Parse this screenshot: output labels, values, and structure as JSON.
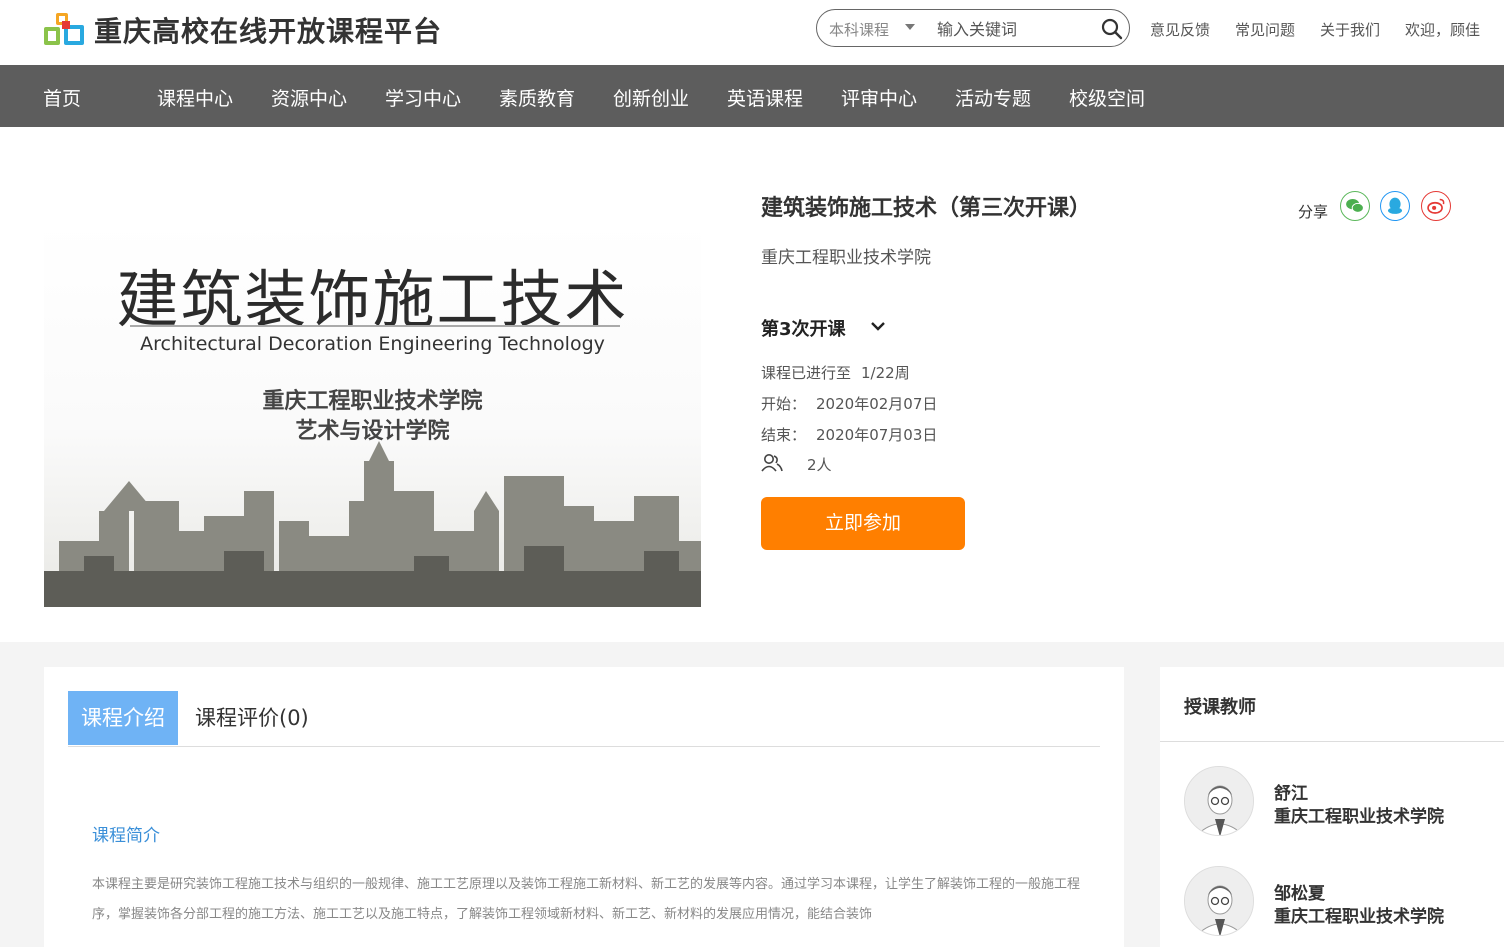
{
  "header": {
    "site_title": "重庆高校在线开放课程平台",
    "search": {
      "category": "本科课程",
      "placeholder": "输入关键词"
    },
    "links": [
      "意见反馈",
      "常见问题",
      "关于我们",
      "欢迎，顾佳"
    ]
  },
  "nav": {
    "items": [
      "首页",
      "课程中心",
      "资源中心",
      "学习中心",
      "素质教育",
      "创新创业",
      "英语课程",
      "评审中心",
      "活动专题",
      "校级空间"
    ]
  },
  "course": {
    "cover": {
      "title": "建筑装饰施工技术",
      "subtitle_en": "Architectural Decoration Engineering Technology",
      "school_line1": "重庆工程职业技术学院",
      "school_line2": "艺术与设计学院"
    },
    "title": "建筑装饰施工技术（第三次开课）",
    "share_label": "分享",
    "share_icons": [
      "wechat-icon",
      "qq-icon",
      "weibo-icon"
    ],
    "school": "重庆工程职业技术学院",
    "session": "第3次开课",
    "progress_label": "课程已进行至",
    "progress_value": "1/22周",
    "start_label": "开始：",
    "start_value": "2020年02月07日",
    "end_label": "结束：",
    "end_value": "2020年07月03日",
    "enrolled": "2人",
    "join_button": "立即参加",
    "accent_color": "#ff7f00"
  },
  "intro": {
    "tabs": [
      "课程介绍",
      "课程评价(0)"
    ],
    "heading": "课程简介",
    "text": "本课程主要是研究装饰工程施工技术与组织的一般规律、施工工艺原理以及装饰工程施工新材料、新工艺的发展等内容。通过学习本课程，让学生了解装饰工程的一般施工程序，掌握装饰各分部工程的施工方法、施工工艺以及施工特点，了解装饰工程领域新材料、新工艺、新材料的发展应用情况，能结合装饰"
  },
  "teachers": {
    "title": "授课教师",
    "list": [
      {
        "name": "舒江",
        "school": "重庆工程职业技术学院"
      },
      {
        "name": "邹松夏",
        "school": "重庆工程职业技术学院"
      }
    ]
  }
}
